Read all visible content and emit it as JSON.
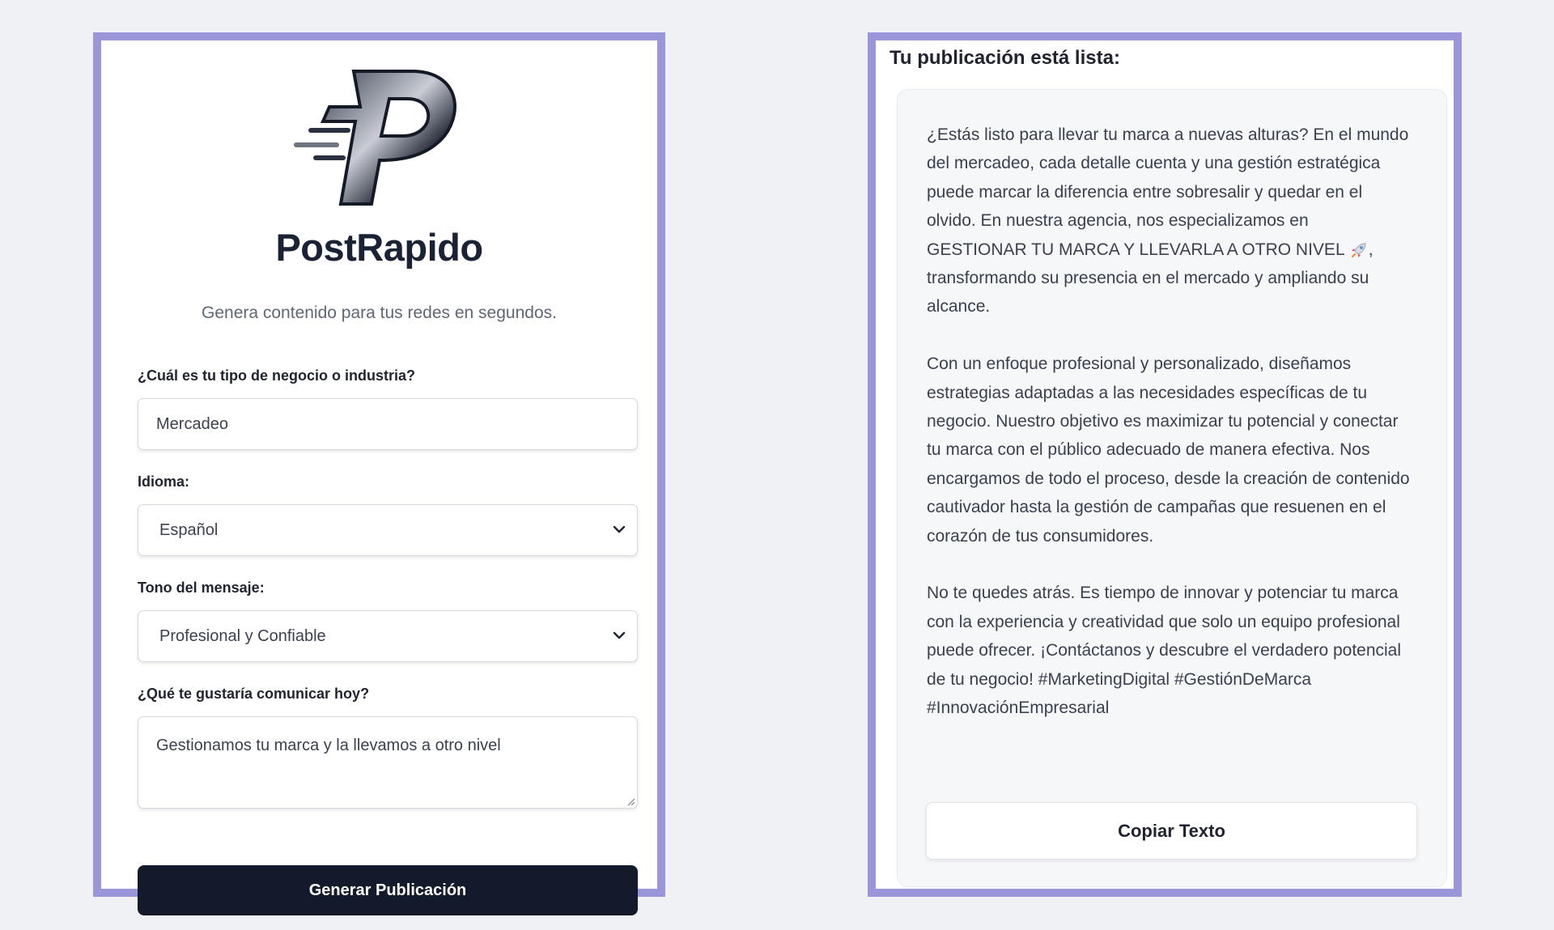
{
  "form": {
    "brand_name": "PostRapido",
    "tagline": "Genera contenido para tus redes en segundos.",
    "industry": {
      "label": "¿Cuál es tu tipo de negocio o industria?",
      "value": "Mercadeo"
    },
    "language": {
      "label": "Idioma:",
      "selected": "Español"
    },
    "tone": {
      "label": "Tono del mensaje:",
      "selected": "Profesional y Confiable"
    },
    "message": {
      "label": "¿Qué te gustaría comunicar hoy?",
      "value": "Gestionamos tu marca y la llevamos a otro nivel"
    },
    "submit_label": "Generar Publicación"
  },
  "result": {
    "title": "Tu publicación está lista:",
    "paragraph_1_before_emoji": "¿Estás listo para llevar tu marca a nuevas alturas? En el mundo del mercadeo, cada detalle cuenta y una gestión estratégica puede marcar la diferencia entre sobresalir y quedar en el olvido. En nuestra agencia, nos especializamos en GESTIONAR TU MARCA Y LLEVARLA A OTRO NIVEL",
    "paragraph_1_emoji_icon": "rocket-icon",
    "paragraph_1_after_emoji": ", transformando su presencia en el mercado y ampliando su alcance.",
    "paragraph_2": "Con un enfoque profesional y personalizado, diseñamos estrategias adaptadas a las necesidades específicas de tu negocio. Nuestro objetivo es maximizar tu potencial y conectar tu marca con el público adecuado de manera efectiva. Nos encargamos de todo el proceso, desde la creación de contenido cautivador hasta la gestión de campañas que resuenen en el corazón de tus consumidores.",
    "paragraph_3": "No te quedes atrás. Es tiempo de innovar y potenciar tu marca con la experiencia y creatividad que solo un equipo profesional puede ofrecer. ¡Contáctanos y descubre el verdadero potencial de tu negocio! #MarketingDigital #GestiónDeMarca #InnovaciónEmpresarial",
    "copy_label": "Copiar Texto"
  },
  "colors": {
    "page_background": "#eff1f4",
    "panel_border": "#9b95d9",
    "primary_button": "#131a2c",
    "result_card": "#f6f7f9"
  }
}
